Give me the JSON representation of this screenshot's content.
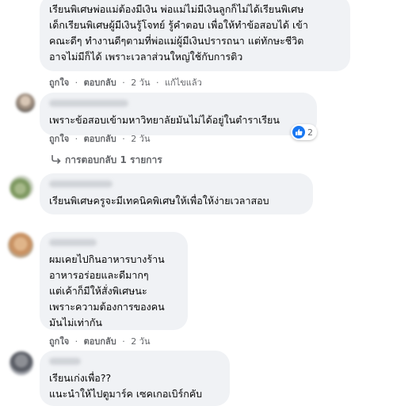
{
  "comments": [
    {
      "lines": [
        "เรียนพิเศษพ่อแม่ต้องมีเงิน พ่อแม่ไม่มีเงินลูกก็ไม่ได้เรียนพิเศษ",
        "เด็กเรียนพิเศษผู้มีเงินรู้โจทย์ รู้คำตอบ เพื่อให้ทำข้อสอบได้ เข้า",
        "คณะดีๆ ทำงานดีๆตามที่พ่อแม่ผู้มีเงินปรารถนา แต่ทักษะชีวิต",
        "อาจไม่มีก็ได้ เพราะเวลาส่วนใหญ่ใช้กับการติว"
      ],
      "like": "ถูกใจ",
      "reply": "ตอบกลับ",
      "time": "2 วัน",
      "edited": "แก้ไขแล้ว"
    },
    {
      "lines": [
        "เพราะข้อสอบเข้ามหาวิทยาลัยมันไม่ได้อยู่ในตำราเรียน"
      ],
      "like": "ถูกใจ",
      "reply": "ตอบกลับ",
      "time": "2 วัน",
      "reaction_count": "2",
      "replies_label": "การตอบกลับ 1 รายการ"
    },
    {
      "lines": [
        "เรียนพิเศษครูจะมีเทคนิคพิเศษให้เพื่อให้ง่ายเวลาสอบ"
      ]
    },
    {
      "lines": [
        "ผมเคยไปกินอาหารบางร้าน",
        "อาหารอร่อยและดีมากๆ",
        "แต่เค้าก็มีให้สั่งพิเศษนะ",
        "เพราะความต้องการของคน",
        "มันไม่เท่ากัน"
      ],
      "like": "ถูกใจ",
      "reply": "ตอบกลับ",
      "time": "2 วัน"
    },
    {
      "lines": [
        "เรียนเก่งเพื่อ??",
        "แนะนำให้ไปตูมาร์ค เซคเกอเบิร์กคับ"
      ]
    }
  ],
  "separator": "·",
  "icons": {
    "reaction": "like-icon",
    "replies": "reply-arrow-icon"
  },
  "colors": {
    "bubble": "#f0f2f5",
    "meta_text": "#65676b",
    "like_blue": "#1877f2"
  }
}
